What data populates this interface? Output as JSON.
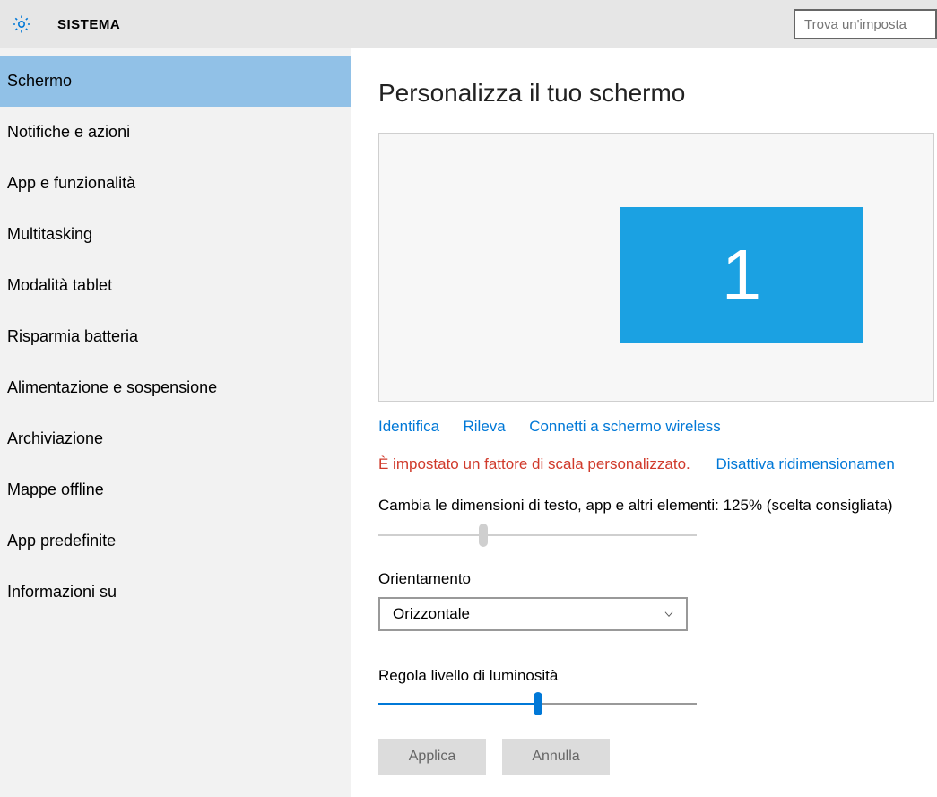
{
  "header": {
    "title": "SISTEMA",
    "search_placeholder": "Trova un'imposta"
  },
  "sidebar": {
    "items": [
      {
        "label": "Schermo",
        "selected": true
      },
      {
        "label": "Notifiche e azioni"
      },
      {
        "label": "App e funzionalità"
      },
      {
        "label": "Multitasking"
      },
      {
        "label": "Modalità tablet"
      },
      {
        "label": "Risparmia batteria"
      },
      {
        "label": "Alimentazione e sospensione"
      },
      {
        "label": "Archiviazione"
      },
      {
        "label": "Mappe offline"
      },
      {
        "label": "App predefinite"
      },
      {
        "label": "Informazioni su"
      }
    ]
  },
  "content": {
    "title": "Personalizza il tuo schermo",
    "display_number": "1",
    "links": {
      "identify": "Identifica",
      "detect": "Rileva",
      "connect_wireless": "Connetti a schermo wireless"
    },
    "scale_warning": "È impostato un fattore di scala personalizzato.",
    "scale_warning_link": "Disattiva ridimensionamen",
    "scale_label": "Cambia le dimensioni di testo, app e altri elementi: 125% (scelta consigliata)",
    "scale_slider": {
      "percent": 33
    },
    "orientation_label": "Orientamento",
    "orientation_value": "Orizzontale",
    "brightness_label": "Regola livello di luminosità",
    "brightness_slider": {
      "percent": 50
    },
    "apply_label": "Applica",
    "cancel_label": "Annulla"
  },
  "colors": {
    "accent": "#0078d7",
    "tile": "#1ba1e2",
    "warning": "#d03a2b"
  }
}
